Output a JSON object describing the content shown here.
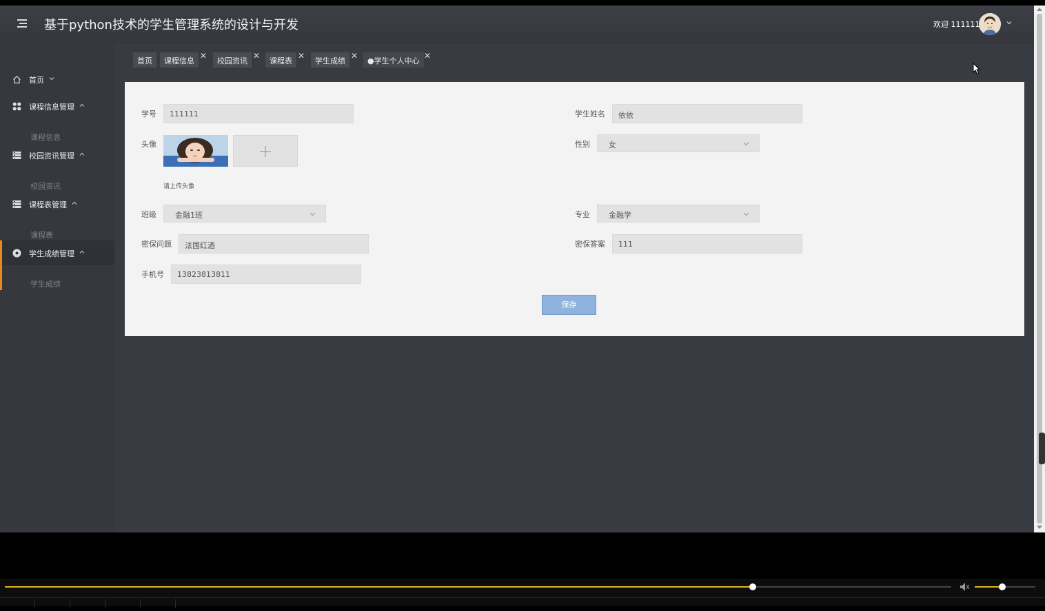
{
  "header": {
    "title": "基于python技术的学生管理系统的设计与开发",
    "welcome": "欢迎 111111"
  },
  "sidebar": {
    "items": [
      {
        "label": "首页",
        "icon": "home-icon"
      },
      {
        "label": "课程信息管理",
        "icon": "grid-icon",
        "sub": "课程信息"
      },
      {
        "label": "校园资讯管理",
        "icon": "list-icon",
        "sub": "校园资讯"
      },
      {
        "label": "课程表管理",
        "icon": "list-icon",
        "sub": "课程表"
      },
      {
        "label": "学生成绩管理",
        "icon": "circle-icon",
        "sub": "学生成绩"
      }
    ]
  },
  "tabs": [
    {
      "label": "首页"
    },
    {
      "label": "课程信息"
    },
    {
      "label": "校园资讯"
    },
    {
      "label": "课程表"
    },
    {
      "label": "学生成绩"
    },
    {
      "label": "●学生个人中心"
    }
  ],
  "form": {
    "student_id_label": "学号",
    "student_id_value": "111111",
    "name_label": "学生姓名",
    "name_value": "依依",
    "avatar_label": "头像",
    "avatar_hint": "请上传头像",
    "gender_label": "性别",
    "gender_value": "女",
    "class_label": "班级",
    "class_value": "金融1班",
    "major_label": "专业",
    "major_value": "金融学",
    "question_label": "密保问题",
    "question_value": "法国红酒",
    "answer_label": "密保答案",
    "answer_value": "111",
    "phone_label": "手机号",
    "phone_value": "13823813811",
    "save_label": "保存"
  },
  "player": {
    "progress": 0.79,
    "volume": 0.45
  },
  "colors": {
    "sidebar_bg": "#36383e",
    "content_bg": "#393b42",
    "active_accent": "#e58a1e",
    "save_button": "#8fb3de",
    "progress": "#e0b520"
  }
}
